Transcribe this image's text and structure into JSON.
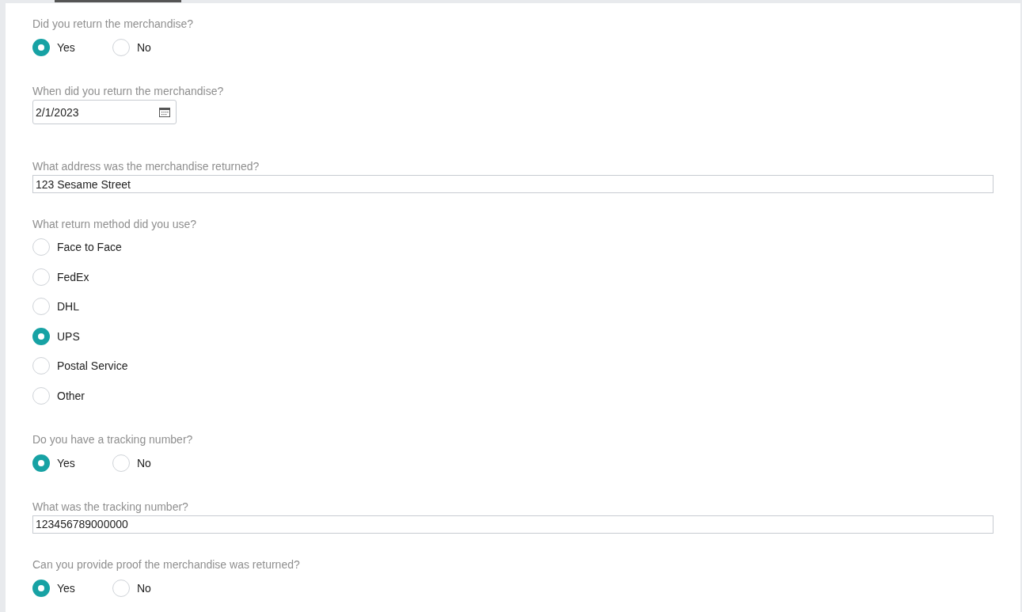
{
  "questions": [
    {
      "kind": "radio",
      "label": "Did you return the merchandise?",
      "options": [
        {
          "label": "Yes",
          "selected": true
        },
        {
          "label": "No",
          "selected": false
        }
      ]
    },
    {
      "kind": "date",
      "label": "When did you return the merchandise?",
      "value": "2/1/2023"
    },
    {
      "kind": "text",
      "label": "What address was the merchandise returned?",
      "value": "123 Sesame Street"
    },
    {
      "kind": "radio-list",
      "label": "What return method did you use?",
      "options": [
        {
          "label": "Face to Face",
          "selected": false
        },
        {
          "label": "FedEx",
          "selected": false
        },
        {
          "label": "DHL",
          "selected": false
        },
        {
          "label": "UPS",
          "selected": true
        },
        {
          "label": "Postal Service",
          "selected": false
        },
        {
          "label": "Other",
          "selected": false
        }
      ]
    },
    {
      "kind": "radio",
      "label": "Do you have a tracking number?",
      "options": [
        {
          "label": "Yes",
          "selected": true
        },
        {
          "label": "No",
          "selected": false
        }
      ]
    },
    {
      "kind": "text",
      "label": "What was the tracking number?",
      "value": "123456789000000"
    },
    {
      "kind": "radio",
      "label": "Can you provide proof the merchandise was returned?",
      "options": [
        {
          "label": "Yes",
          "selected": true
        },
        {
          "label": "No",
          "selected": false
        }
      ]
    }
  ]
}
